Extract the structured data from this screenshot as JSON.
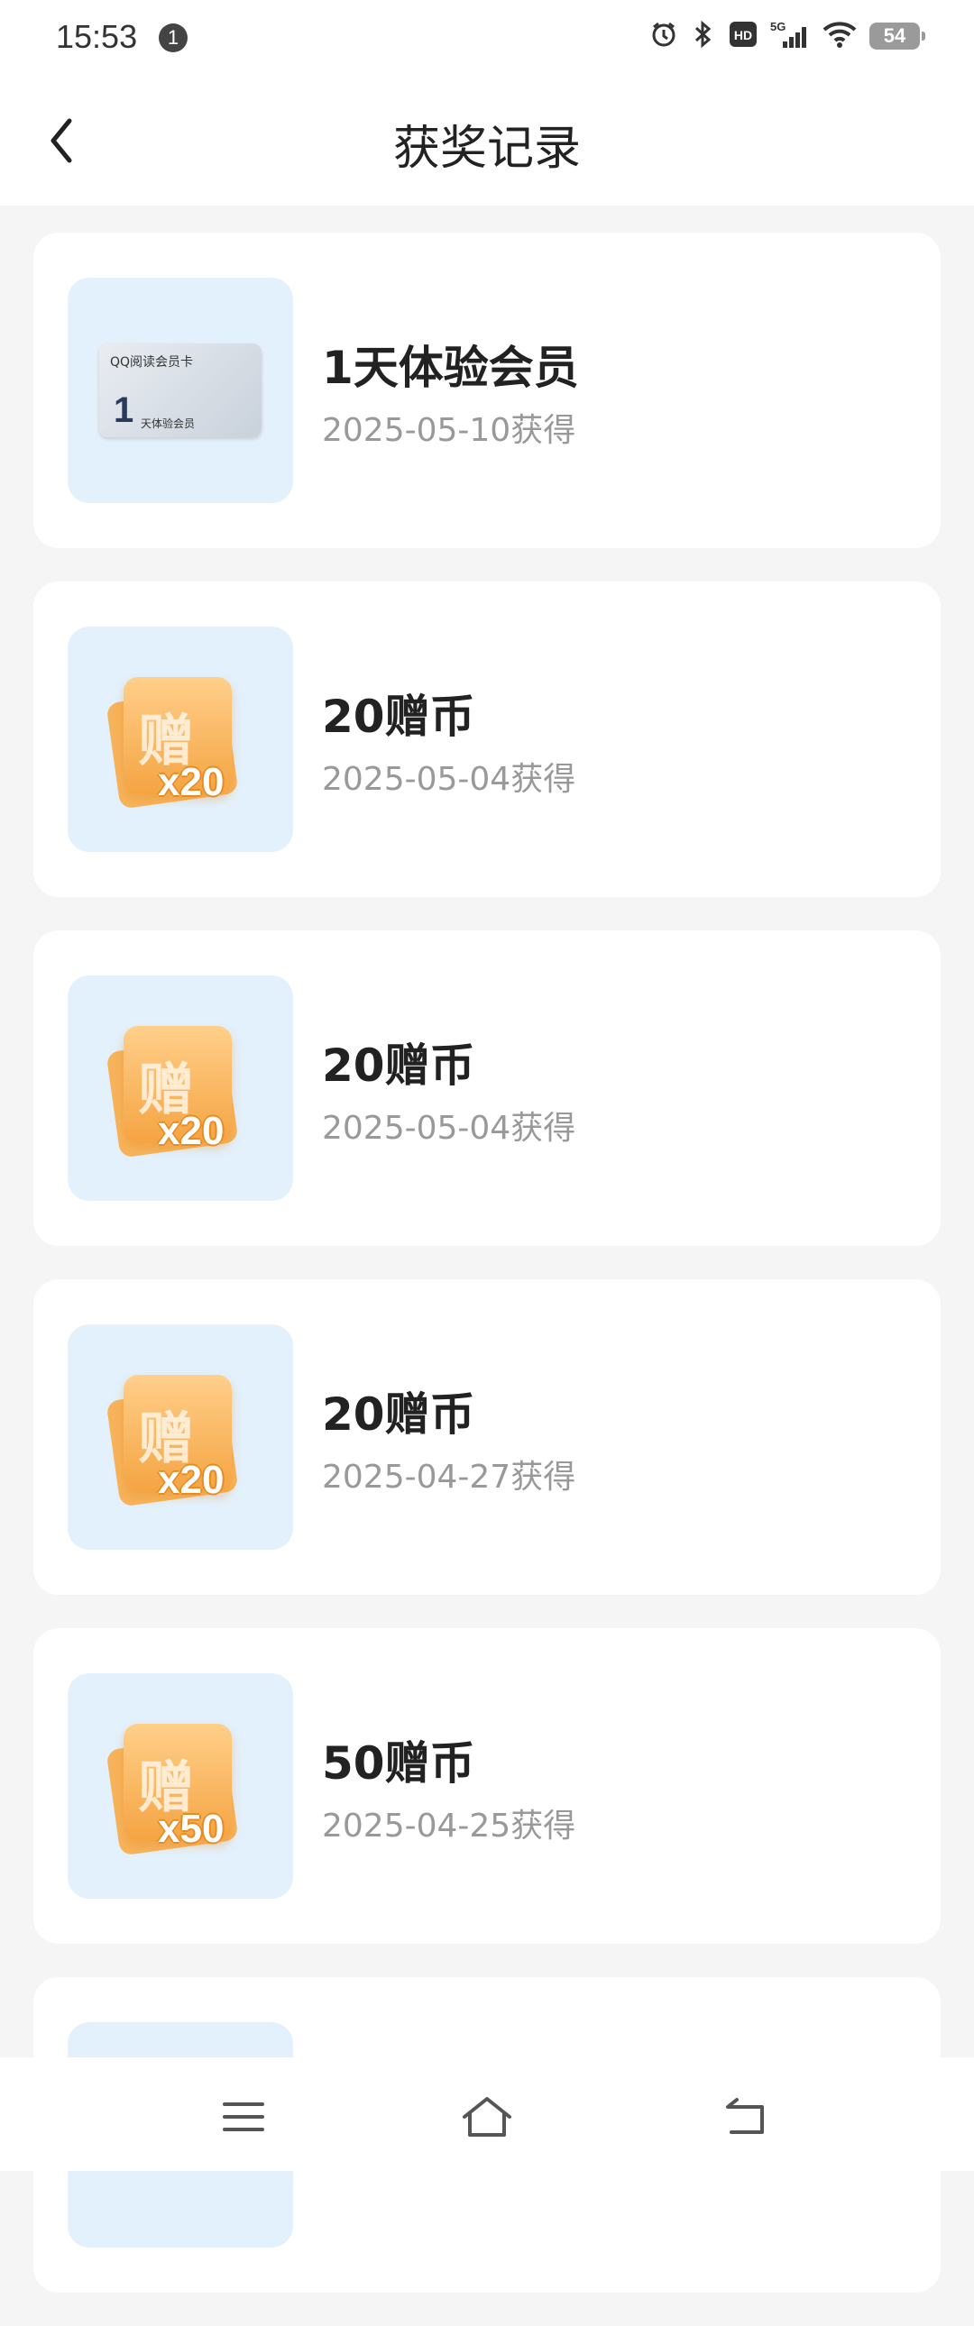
{
  "status": {
    "time": "15:53",
    "notif_count": "1",
    "network": "5G",
    "battery": "54"
  },
  "nav": {
    "title": "获奖记录",
    "back_icon": "chevron-left-icon"
  },
  "records": [
    {
      "type": "member",
      "title": "1天体验会员",
      "date": "2025-05-10获得",
      "thumb": {
        "brand": "QQ阅读会员卡",
        "num": "1",
        "label": "天体验会员"
      }
    },
    {
      "type": "coin",
      "title": "20赠币",
      "date": "2025-05-04获得",
      "thumb": {
        "char": "赠",
        "mult": "x20"
      }
    },
    {
      "type": "coin",
      "title": "20赠币",
      "date": "2025-05-04获得",
      "thumb": {
        "char": "赠",
        "mult": "x20"
      }
    },
    {
      "type": "coin",
      "title": "20赠币",
      "date": "2025-04-27获得",
      "thumb": {
        "char": "赠",
        "mult": "x20"
      }
    },
    {
      "type": "coin",
      "title": "50赠币",
      "date": "2025-04-25获得",
      "thumb": {
        "char": "赠",
        "mult": "x50"
      }
    },
    {
      "type": "partial",
      "title": "",
      "date": ""
    }
  ],
  "bottom_nav": [
    "menu-icon",
    "home-icon",
    "back-icon"
  ]
}
